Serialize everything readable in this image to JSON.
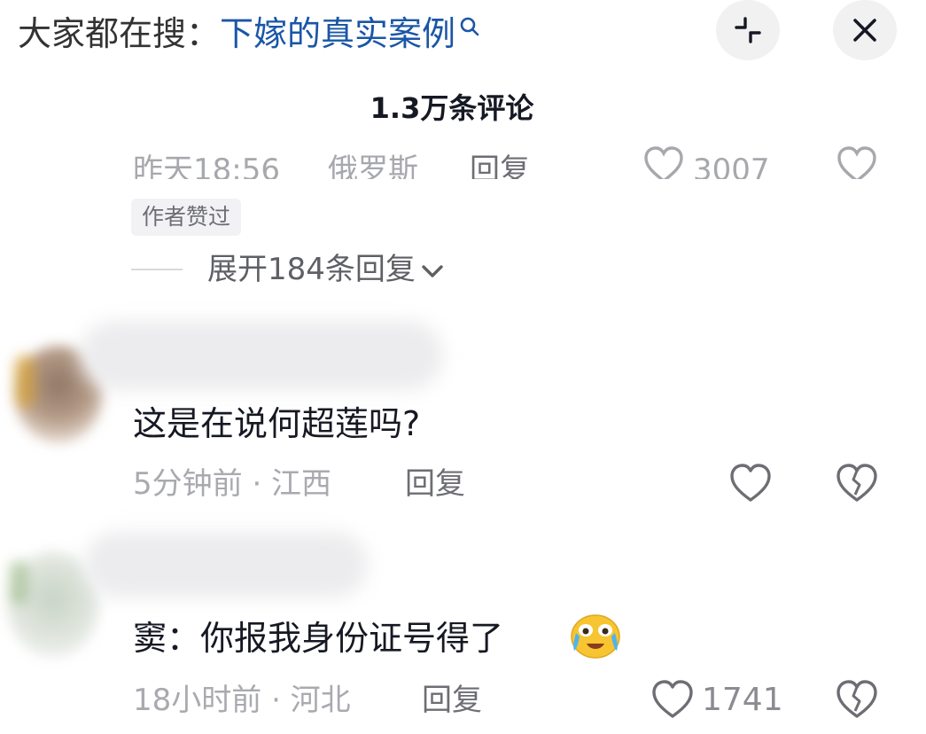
{
  "header": {
    "search_prefix": "大家都在搜：",
    "search_query": "下嫁的真实案例",
    "title": "1.3万条评论"
  },
  "previous_comment": {
    "time_clipped": "昨天18:56",
    "location_clipped": "俄罗斯",
    "reply_label": "回复",
    "likes_clipped": "3007",
    "badge": "作者赞过",
    "expand_label": "展开184条回复"
  },
  "comments": [
    {
      "text": "这是在说何超莲吗?",
      "meta": "5分钟前 · 江西",
      "reply_label": "回复",
      "likes": ""
    },
    {
      "text": "窦：你报我身份证号得了",
      "meta": "18小时前 · 河北",
      "reply_label": "回复",
      "likes": "1741"
    }
  ],
  "icons": {
    "search": "search-icon",
    "collapse": "collapse-icon",
    "close": "close-icon",
    "like": "heart-icon",
    "dislike": "broken-heart-icon",
    "emoji": "crying-laughing-emoji"
  },
  "colors": {
    "query_link": "#1a56a6",
    "meta_text": "#a9aaaf",
    "button_bg": "#f1f1f2"
  }
}
